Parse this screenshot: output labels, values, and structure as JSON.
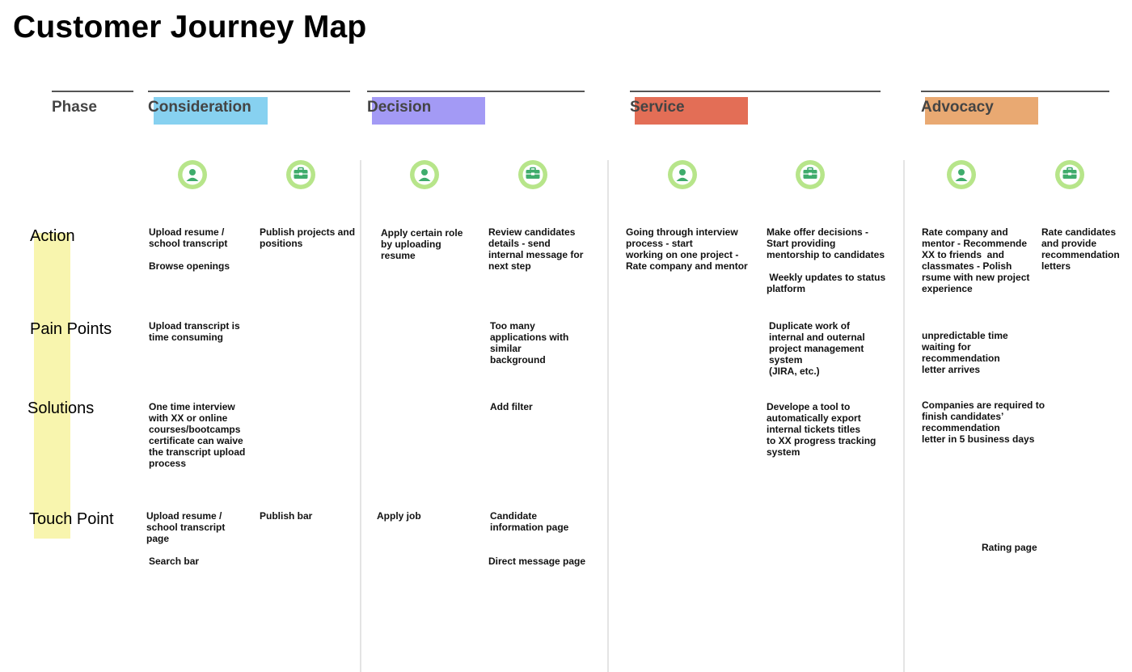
{
  "title": "Customer Journey Map",
  "colors": {
    "consideration": "#87d1f0",
    "decision": "#a39af5",
    "service": "#e36e56",
    "advocacy": "#e9a972",
    "highlight": "#f8f5ae",
    "icon_ring": "#b7e58a",
    "icon_fill": "#3fac6c"
  },
  "phase_header": "Phase",
  "phases": [
    "Consideration",
    "Decision",
    "Service",
    "Advocacy"
  ],
  "icons": [
    "user-icon",
    "briefcase-icon",
    "user-icon",
    "briefcase-icon",
    "user-icon",
    "briefcase-icon",
    "user-icon",
    "briefcase-icon"
  ],
  "rows": [
    "Action",
    "Pain Points",
    "Solutions",
    "Touch Point"
  ],
  "cells": {
    "c1_action_a": "Upload resume /\nschool transcript",
    "c1_action_b": "Browse openings",
    "c2_action": "Publish projects and\npositions",
    "c3_action": "Apply certain role\nby uploading\nresume",
    "c4_action": "Review candidates\ndetails - send\ninternal message for\nnext step",
    "c5_action": "Going through interview\nprocess - start\nworking on one project -\nRate company and mentor",
    "c6_action_a": "Make offer decisions -\nStart providing\nmentorship to candidates",
    "c6_action_b": " Weekly updates to status\nplatform",
    "c7_action": "Rate company and\nmentor - Recommende\nXX to friends  and\nclassmates - Polish\nrsume with new project\nexperience",
    "c8_action": "Rate candidates\nand provide\nrecommendation\nletters",
    "c1_pain": "Upload transcript is\ntime consuming",
    "c4_pain": "Too many\napplications with\nsimilar\nbackground",
    "c6_pain": "Duplicate work of\ninternal and outernal\nproject management\nsystem\n(JIRA, etc.)",
    "c7_pain": "unpredictable time\nwaiting for\nrecommendation\nletter arrives",
    "c1_solution": "One time interview\nwith XX or online\ncourses/bootcamps\ncertificate can waive\nthe transcript upload\nprocess",
    "c4_solution": "Add filter",
    "c6_solution": "Develope a tool to\nautomatically export\ninternal tickets titles\nto XX progress tracking\nsystem",
    "c7_solution": "Companies are required to\nfinish candidates’\nrecommendation\nletter in 5 business days",
    "c1_touch_a": "Upload resume /\nschool transcript\npage",
    "c1_touch_b": "Search bar",
    "c2_touch": "Publish bar",
    "c3_touch": "Apply job",
    "c4_touch_a": "Candidate\ninformation page",
    "c4_touch_b": "Direct message page",
    "c78_touch": "Rating page"
  }
}
